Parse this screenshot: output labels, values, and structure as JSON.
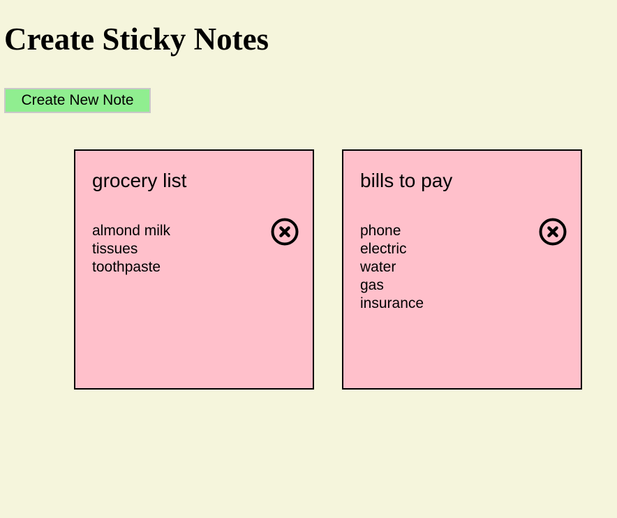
{
  "page": {
    "title": "Create Sticky Notes"
  },
  "toolbar": {
    "create_label": "Create New Note"
  },
  "colors": {
    "background": "#f5f5dc",
    "button": "#90ee90",
    "note": "#ffc0cb"
  },
  "notes": [
    {
      "title": "grocery list",
      "items": [
        "almond milk",
        "tissues",
        "toothpaste"
      ],
      "delete_icon": "close-circle-icon"
    },
    {
      "title": "bills to pay",
      "items": [
        "phone",
        "electric",
        "water",
        "gas",
        "insurance"
      ],
      "delete_icon": "close-circle-icon"
    }
  ]
}
